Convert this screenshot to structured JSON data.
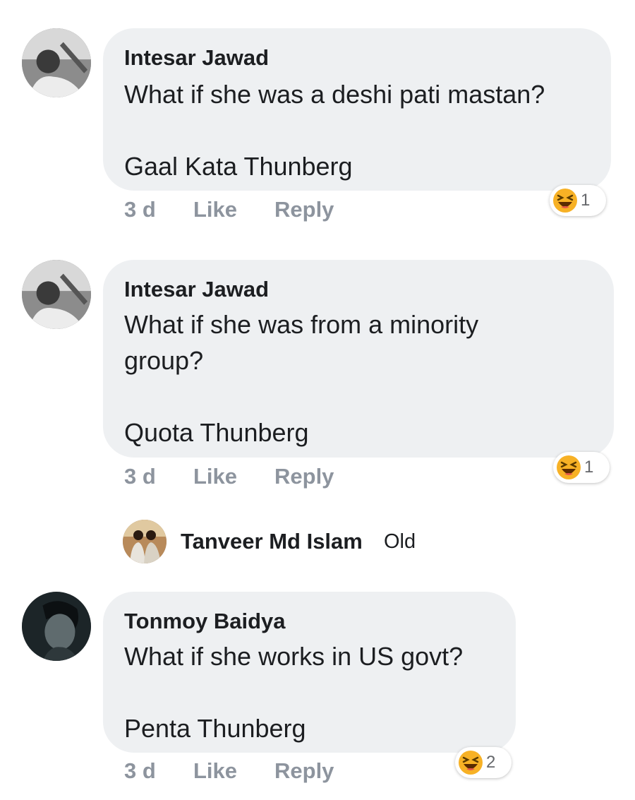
{
  "comments": [
    {
      "author": "Intesar Jawad",
      "text": "What if she was a deshi pati mastan?\n\nGaal Kata Thunberg",
      "time": "3 d",
      "like_label": "Like",
      "reply_label": "Reply",
      "reaction": {
        "icon": "laughing-emoji-icon",
        "count": "1"
      }
    },
    {
      "author": "Intesar Jawad",
      "text": "What if she was from a minority\ngroup?\n\nQuota Thunberg",
      "time": "3 d",
      "like_label": "Like",
      "reply_label": "Reply",
      "reaction": {
        "icon": "laughing-emoji-icon",
        "count": "1"
      }
    },
    {
      "author": "Tonmoy Baidya",
      "text": "What if she works in US govt?\n\nPenta Thunberg",
      "time": "3 d",
      "like_label": "Like",
      "reply_label": "Reply",
      "reaction": {
        "icon": "laughing-emoji-icon",
        "count": "2"
      }
    }
  ],
  "reply_preview": {
    "author": "Tanveer Md Islam",
    "text": "Old"
  },
  "colors": {
    "bubble": "#eef0f2",
    "action_text": "#8d949e",
    "name_text": "#1c1e21",
    "emoji_yellow": "#f7b125"
  }
}
